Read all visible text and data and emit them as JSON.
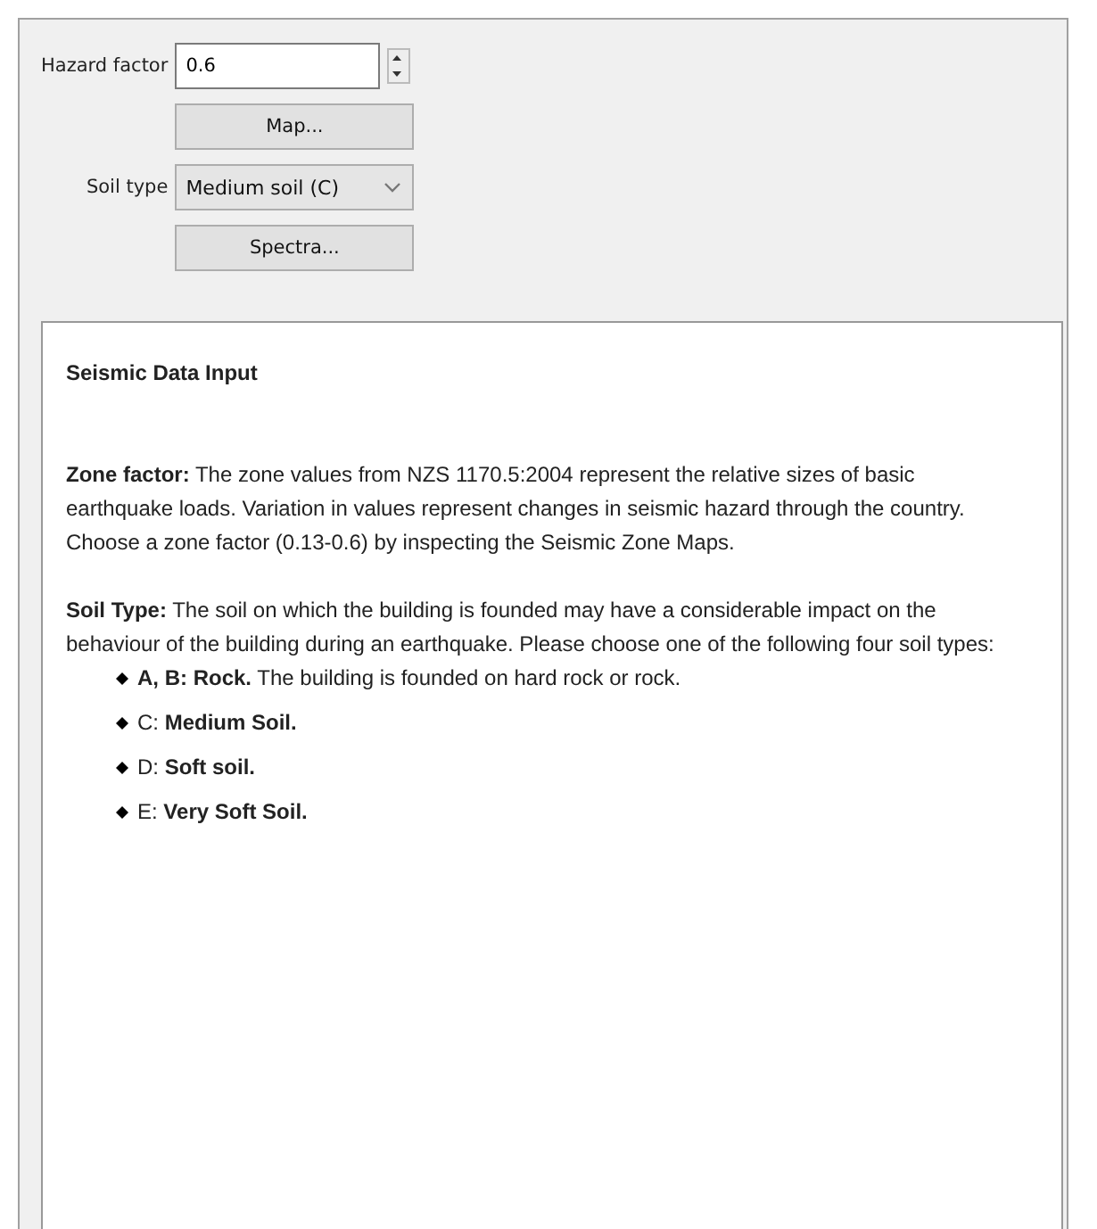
{
  "hazard_factor": {
    "label": "Hazard factor",
    "value": "0.6"
  },
  "map_button": "Map...",
  "soil_type": {
    "label": "Soil type",
    "value": "Medium soil (C)"
  },
  "spectra_button": "Spectra...",
  "help": {
    "title": "Seismic Data Input",
    "paragraphs": [
      "**Zone factor:** The zone values from NZS 1170.5:2004 represent the relative sizes of basic earthquake loads. Variation in values represent changes in seismic hazard through the country. Choose a zone factor (0.13-0.6) by inspecting the Seismic Zone Maps.",
      "**Soil Type:** The soil on which the building is founded may have a considerable impact on the behaviour of the building during an earthquake. Please choose one of the following four soil types:"
    ],
    "items": [
      "**A, B: Rock.** The building is founded on hard rock or rock.",
      "C: **Medium Soil.**",
      "D: **Soft soil.**",
      "E: **Very Soft Soil.**"
    ]
  }
}
